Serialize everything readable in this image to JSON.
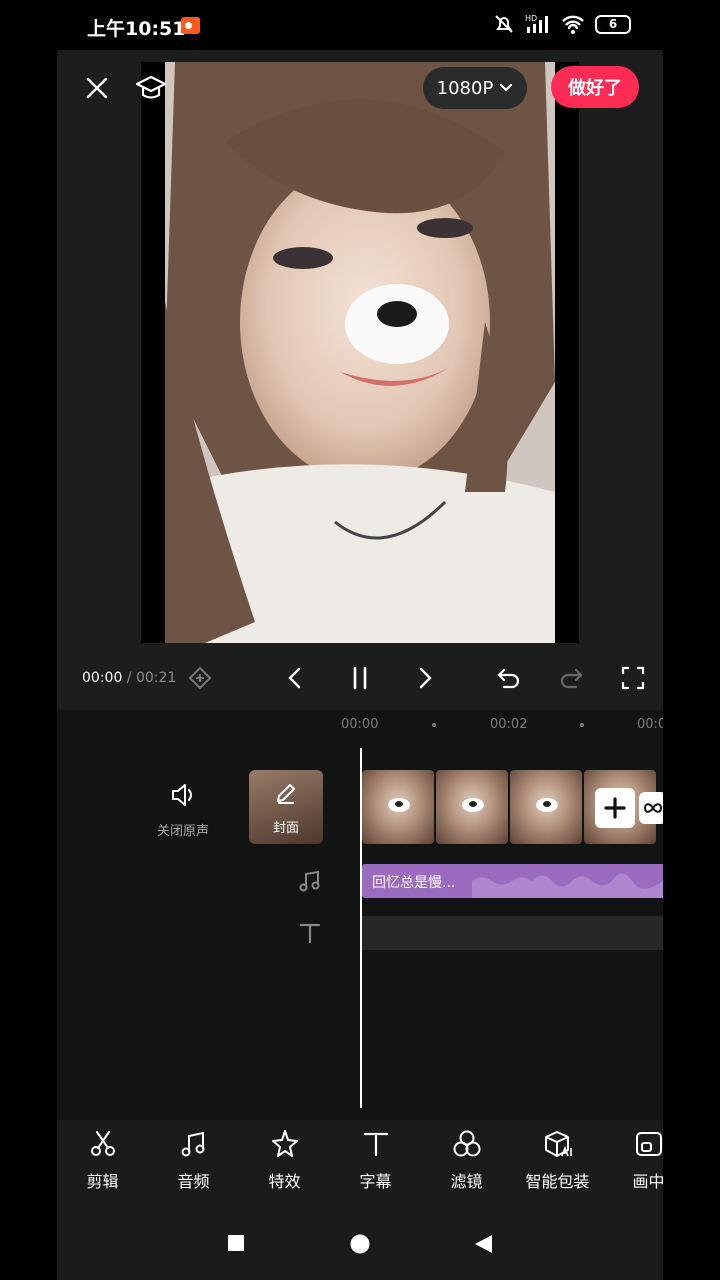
{
  "status": {
    "time": "上午10:51",
    "network": "HD",
    "battery": "6"
  },
  "topbar": {
    "resolution": "1080P",
    "done_label": "做好了"
  },
  "playback": {
    "current": "00:00",
    "separator": " / ",
    "total": "00:21"
  },
  "ruler": {
    "t0": "00:00",
    "t1": "00:02",
    "t2": "00:0"
  },
  "timeline": {
    "mute_label": "关闭原声",
    "cover_label": "封面",
    "audio_clip_label": "回忆总是慢..."
  },
  "toolbar": {
    "items": [
      {
        "label": "剪辑",
        "icon": "scissors-icon"
      },
      {
        "label": "音频",
        "icon": "music-note-icon"
      },
      {
        "label": "特效",
        "icon": "sparkle-star-icon"
      },
      {
        "label": "字幕",
        "icon": "text-icon"
      },
      {
        "label": "滤镜",
        "icon": "filter-circles-icon"
      },
      {
        "label": "智能包装",
        "icon": "ai-box-icon"
      },
      {
        "label": "画中",
        "icon": "picture-in-picture-icon"
      }
    ]
  },
  "colors": {
    "accent": "#fe2c55",
    "audio_track": "#9b6bc0",
    "background": "#1a1b1b"
  }
}
